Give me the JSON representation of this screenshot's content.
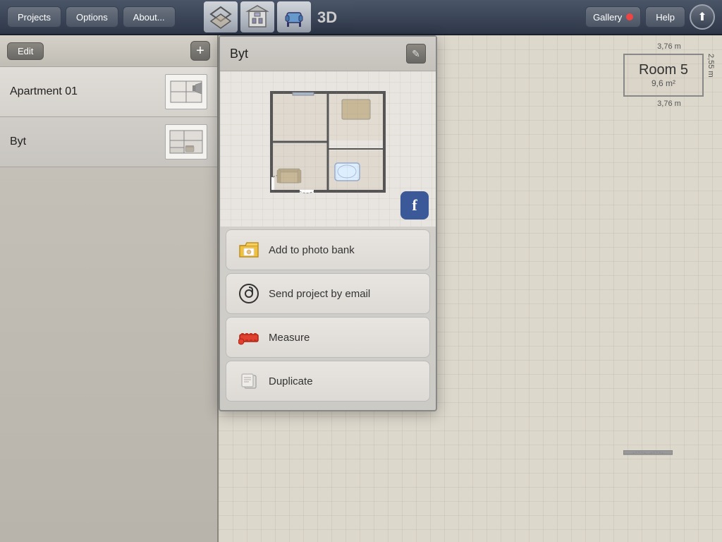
{
  "toolbar": {
    "projects_label": "Projects",
    "options_label": "Options",
    "about_label": "About...",
    "gallery_label": "Gallery",
    "help_label": "Help",
    "icon_3d": "3D"
  },
  "left_panel": {
    "edit_label": "Edit",
    "add_label": "+",
    "projects": [
      {
        "id": 1,
        "name": "Apartment 01"
      },
      {
        "id": 2,
        "name": "Byt"
      }
    ]
  },
  "popup": {
    "title": "Byt",
    "edit_icon": "✎",
    "facebook_label": "f",
    "actions": [
      {
        "id": "photo-bank",
        "label": "Add to photo bank",
        "icon": "📁"
      },
      {
        "id": "send-email",
        "label": "Send project by email",
        "icon": "✉"
      },
      {
        "id": "measure",
        "label": "Measure",
        "icon": "📏"
      },
      {
        "id": "duplicate",
        "label": "Duplicate",
        "icon": "📋"
      }
    ]
  },
  "floor_plan": {
    "room5_title": "Room 5",
    "room5_area": "9,6 m²",
    "dim_top": "3,76 m",
    "dim_bottom": "3,76 m",
    "dim_right": "2,55 m"
  }
}
